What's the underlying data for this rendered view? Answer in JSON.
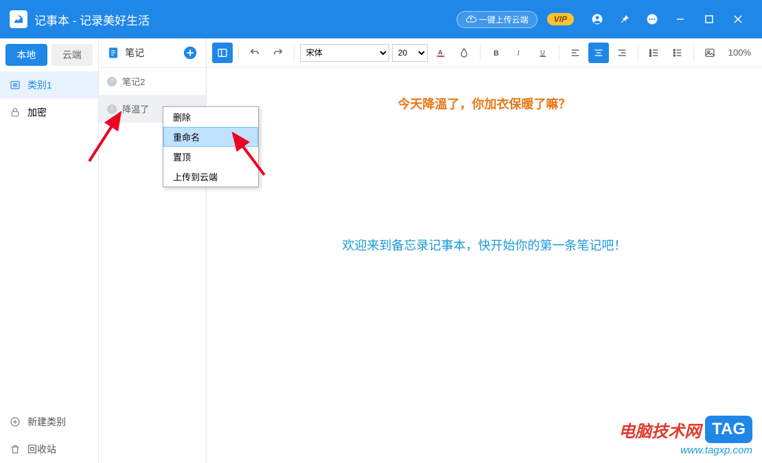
{
  "titlebar": {
    "app_title": "记事本 - 记录美好生活",
    "cloud_btn": "一键上传云端",
    "vip": "VIP"
  },
  "sidebar1": {
    "tab_local": "本地",
    "tab_cloud": "云端",
    "category": "类别1",
    "encrypt": "加密",
    "new_category": "新建类别",
    "recycle": "回收站"
  },
  "notes": {
    "header": "笔记",
    "items": [
      "笔记2",
      "降温了"
    ]
  },
  "toolbar": {
    "font": "宋体",
    "size": "20",
    "zoom": "100%"
  },
  "canvas": {
    "line1": "今天降溫了，你加衣保暖了嘛？",
    "line2": "欢迎来到备忘录记事本，快开始你的第一条笔记吧！"
  },
  "ctx": {
    "delete": "删除",
    "rename": "重命名",
    "pin": "置顶",
    "upload": "上传到云端"
  },
  "watermark": {
    "text": "电脑技术网",
    "tag": "TAG",
    "url": "www.tagxp.com"
  }
}
